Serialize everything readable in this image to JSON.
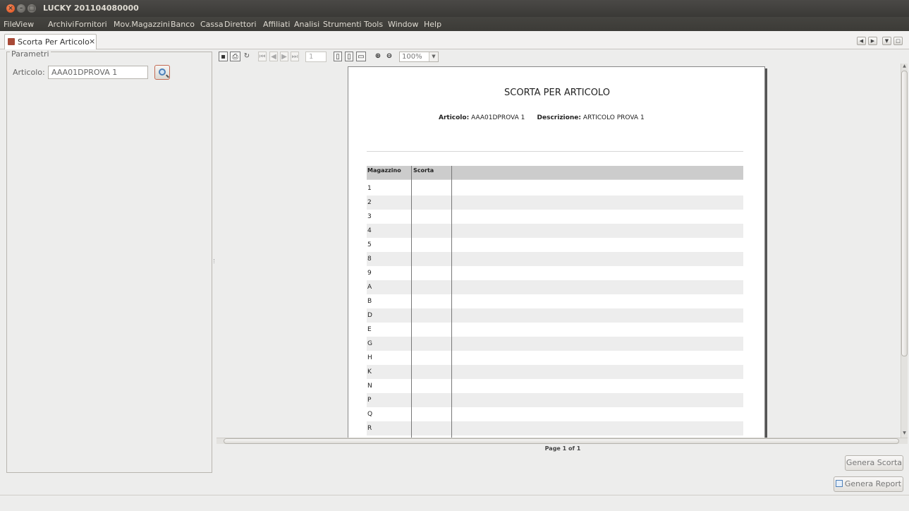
{
  "window": {
    "title": "LUCKY 201104080000"
  },
  "menu": [
    "File",
    "View",
    "Archivi",
    "Fornitori",
    "Mov.Magazzini",
    "Banco",
    "Cassa",
    "Direttori",
    "Affiliati",
    "Analisi",
    "Strumenti",
    "Tools",
    "Window",
    "Help"
  ],
  "tab": {
    "label": "Scorta Per Articolo",
    "close": "×"
  },
  "params": {
    "legend": "Parametri",
    "articolo_label": "Articolo:",
    "articolo_value": "AAA01DPROVA 1"
  },
  "viewer": {
    "page_input": "1",
    "zoom": "100%",
    "page_label": "Page 1 of 1"
  },
  "report": {
    "title": "SCORTA PER ARTICOLO",
    "articolo_key": "Articolo:",
    "articolo_value": "AAA01DPROVA 1",
    "descrizione_key": "Descrizione:",
    "descrizione_value": "ARTICOLO PROVA 1",
    "columns": [
      "Magazzino",
      "Scorta"
    ],
    "rows": [
      "1",
      "2",
      "3",
      "4",
      "5",
      "8",
      "9",
      "A",
      "B",
      "D",
      "E",
      "G",
      "H",
      "K",
      "N",
      "P",
      "Q",
      "R"
    ]
  },
  "buttons": {
    "genera_scorta": "Genera Scorta",
    "genera_report": "Genera Report"
  }
}
